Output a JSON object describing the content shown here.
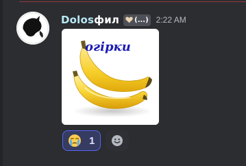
{
  "message": {
    "author": {
      "name_prefix": "Dolos",
      "name_suffix": "фил",
      "name_color": "#ffffff",
      "avatar": "silhouette-avatar"
    },
    "role_tag": {
      "icon": "heart-icon",
      "text": "(...)"
    },
    "timestamp": "2:22 AM",
    "attachment": {
      "kind": "image",
      "depicts": "bananas-icon",
      "caption": "огірки",
      "caption_color": "#1b1bb4"
    },
    "reactions": [
      {
        "emoji": "crying-face-emoji",
        "count": "1",
        "selected": true,
        "accent": "#5865f2"
      }
    ],
    "add_reaction": {
      "icon": "smiley-add-reaction-icon"
    }
  },
  "colors": {
    "background": "#2b2d31",
    "new_messages_line": "#f23f43"
  }
}
